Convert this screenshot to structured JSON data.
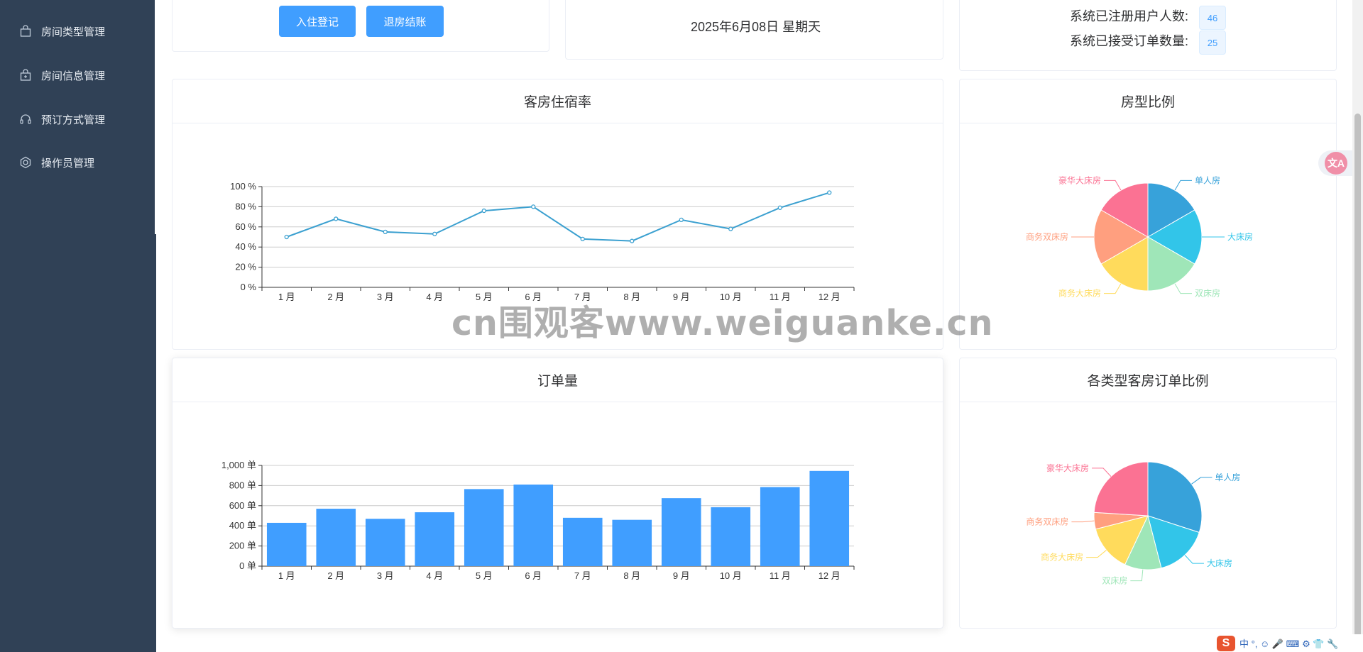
{
  "sidebar": {
    "items": [
      {
        "label": "房间类型管理",
        "icon": "shopping-bag-icon"
      },
      {
        "label": "房间信息管理",
        "icon": "shopping-bag-add-icon"
      },
      {
        "label": "预订方式管理",
        "icon": "headset-icon"
      },
      {
        "label": "操作员管理",
        "icon": "settings-icon"
      }
    ]
  },
  "top": {
    "checkin_button": "入住登记",
    "checkout_button": "退房结账",
    "date": "2025年6月08日 星期天",
    "registered_users_label": "系统已注册用户人数:",
    "registered_users_value": "46",
    "orders_label": "系统已接受订单数量:",
    "orders_value": "25"
  },
  "panels": {
    "occupancy_title": "客房住宿率",
    "room_ratio_title": "房型比例",
    "orders_title": "订单量",
    "order_ratio_title": "各类型客房订单比例"
  },
  "colors": {
    "sidebar_bg": "#304156",
    "primary": "#409eff",
    "line": "#3ba0d0"
  },
  "chart_data": [
    {
      "type": "line",
      "title": "客房住宿率",
      "categories": [
        "1 月",
        "2 月",
        "3 月",
        "4 月",
        "5 月",
        "6 月",
        "7 月",
        "8 月",
        "9 月",
        "10 月",
        "11 月",
        "12 月"
      ],
      "values": [
        50,
        68,
        55,
        53,
        76,
        80,
        48,
        46,
        67,
        58,
        79,
        94
      ],
      "y_ticks": [
        "0 %",
        "20 %",
        "40 %",
        "60 %",
        "80 %",
        "100 %"
      ],
      "ylim": [
        0,
        100
      ],
      "grid": true
    },
    {
      "type": "pie",
      "title": "房型比例",
      "labels": [
        "单人房",
        "大床房",
        "双床房",
        "商务大床房",
        "商务双床房",
        "豪华大床房"
      ],
      "values": [
        1,
        1,
        1,
        1,
        1,
        1
      ],
      "colors": [
        "#37a2da",
        "#32c5e9",
        "#9fe6b8",
        "#ffdb5c",
        "#ff9f7f",
        "#fb7293"
      ]
    },
    {
      "type": "bar",
      "title": "订单量",
      "categories": [
        "1 月",
        "2 月",
        "3 月",
        "4 月",
        "5 月",
        "6 月",
        "7 月",
        "8 月",
        "9 月",
        "10 月",
        "11 月",
        "12 月"
      ],
      "values": [
        430,
        570,
        470,
        535,
        765,
        810,
        480,
        460,
        675,
        585,
        785,
        945
      ],
      "y_ticks": [
        "0 单",
        "200 单",
        "400 单",
        "600 单",
        "800 单",
        "1,000 单"
      ],
      "ylim": [
        0,
        1000
      ],
      "grid": true
    },
    {
      "type": "pie",
      "title": "各类型客房订单比例",
      "labels": [
        "单人房",
        "大床房",
        "双床房",
        "商务大床房",
        "商务双床房",
        "豪华大床房"
      ],
      "values": [
        30,
        16,
        11,
        14,
        5,
        24
      ],
      "colors": [
        "#37a2da",
        "#32c5e9",
        "#9fe6b8",
        "#ffdb5c",
        "#ff9f7f",
        "#fb7293"
      ]
    }
  ],
  "watermark": "cn围观客www.weiguanke.cn",
  "overlay": {
    "translate_glyph": "文A",
    "ime_logo": "S",
    "ime_text": "中 °, ☺ 🎤 ⌨ ⚙ 👕 🔧"
  }
}
